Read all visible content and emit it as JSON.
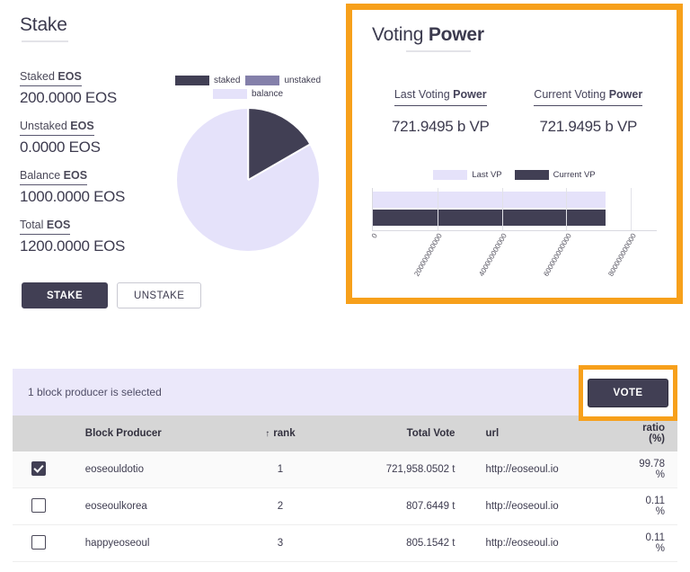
{
  "stake_panel": {
    "title_light": "Stake",
    "title_bold": "",
    "stats": [
      {
        "label_light": "Staked ",
        "label_bold": "EOS",
        "value": "200.0000 EOS"
      },
      {
        "label_light": "Unstaked ",
        "label_bold": "EOS",
        "value": "0.0000 EOS"
      },
      {
        "label_light": "Balance ",
        "label_bold": "EOS",
        "value": "1000.0000 EOS"
      },
      {
        "label_light": "Total ",
        "label_bold": "EOS",
        "value": "1200.0000 EOS"
      }
    ],
    "buttons": {
      "stake": "STAKE",
      "unstake": "UNSTAKE"
    }
  },
  "voting_power_panel": {
    "title_light": "Voting ",
    "title_bold": "Power",
    "highlight_color": "#f7a01b",
    "columns": [
      {
        "label_light": "Last Voting ",
        "label_bold": "Power",
        "value": "721.9495 b VP"
      },
      {
        "label_light": "Current Voting ",
        "label_bold": "Power",
        "value": "721.9495 b VP"
      }
    ]
  },
  "table_section": {
    "selected_text": "1 block producer is selected",
    "vote_button": "VOTE",
    "headers": {
      "block_producer": "Block Producer",
      "rank": "rank",
      "rank_sort_icon": "↑",
      "total_vote": "Total Vote",
      "url": "url",
      "ratio": "ratio (%)"
    },
    "rows": [
      {
        "checked": true,
        "block_producer": "eoseouldotio",
        "rank": "1",
        "total_vote": "721,958.0502 t",
        "url": "http://eoseoul.io",
        "ratio": "99.78 %"
      },
      {
        "checked": false,
        "block_producer": "eoseoulkorea",
        "rank": "2",
        "total_vote": "807.6449 t",
        "url": "http://eoseoul.io",
        "ratio": "0.11 %"
      },
      {
        "checked": false,
        "block_producer": "happyeoseoul",
        "rank": "3",
        "total_vote": "805.1542 t",
        "url": "http://eoseoul.io",
        "ratio": "0.11 %"
      }
    ]
  },
  "chart_data": [
    {
      "type": "pie",
      "title": "",
      "legend": [
        "staked",
        "unstaked",
        "balance"
      ],
      "legend_position": "top",
      "categories": [
        "staked",
        "unstaked",
        "balance"
      ],
      "values": [
        200.0,
        0.0,
        1000.0
      ],
      "unit": "EOS",
      "colors": [
        "#413f54",
        "#8480aa",
        "#e5e2fa"
      ],
      "start_angle_deg": 0,
      "slice_angles_deg": [
        60,
        0,
        300
      ]
    },
    {
      "type": "bar",
      "orientation": "horizontal",
      "title": "",
      "categories": [
        "Last VP",
        "Current VP"
      ],
      "series": [
        {
          "name": "Last VP",
          "values": [
            721949500000
          ],
          "color": "#e5e2fa"
        },
        {
          "name": "Current VP",
          "values": [
            721949500000
          ],
          "color": "#413f54"
        }
      ],
      "legend": [
        "Last VP",
        "Current VP"
      ],
      "legend_position": "top",
      "xlabel": "",
      "ylabel": "",
      "xlim": [
        0,
        880000000000
      ],
      "xticks": [
        "0",
        "200000000000",
        "400000000000",
        "600000000000",
        "800000000000"
      ],
      "xtick_values": [
        0,
        200000000000,
        400000000000,
        600000000000,
        800000000000
      ],
      "grid": true
    }
  ]
}
